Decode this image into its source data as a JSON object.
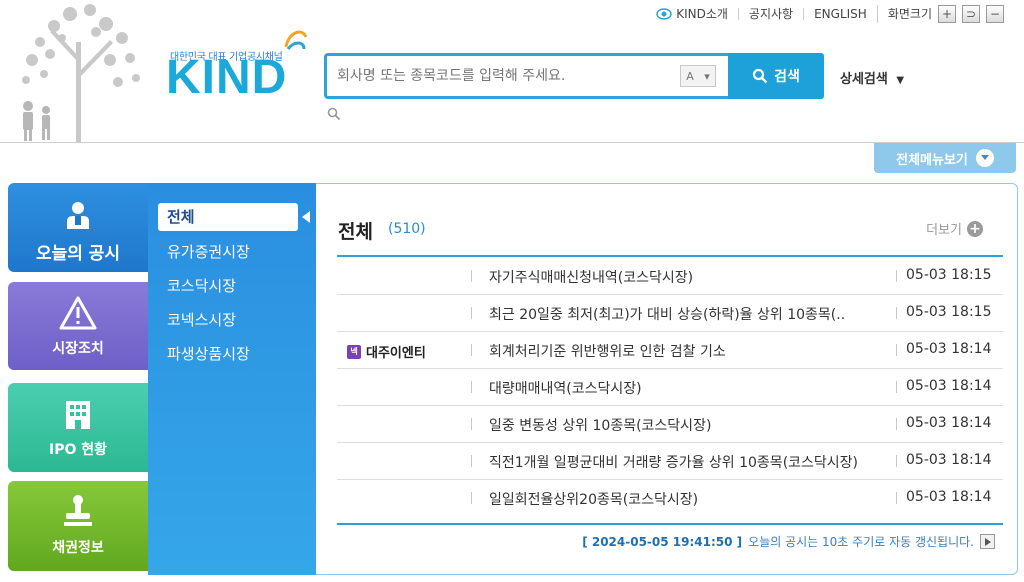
{
  "header": {
    "logo_sub": "대한민국 대표 기업공시채널",
    "logo_text": "KIND",
    "util": {
      "about": "KIND소개",
      "notice": "공지사항",
      "english": "ENGLISH",
      "screen_size": "화면크기",
      "plus": "+",
      "reset": "⊃",
      "minus": "−"
    },
    "search": {
      "placeholder": "회사명 또는 종목코드를 입력해 주세요.",
      "font_selector": "A",
      "button": "검색"
    },
    "advanced_search": "상세검색",
    "all_menu": "전체메뉴보기"
  },
  "tabs": [
    {
      "label": "오늘의 공시"
    },
    {
      "label": "시장조치"
    },
    {
      "label": "IPO 현황"
    },
    {
      "label": "채권정보"
    }
  ],
  "submenu": [
    {
      "label": "전체"
    },
    {
      "label": "유가증권시장"
    },
    {
      "label": "코스닥시장"
    },
    {
      "label": "코넥스시장"
    },
    {
      "label": "파생상품시장"
    }
  ],
  "main": {
    "title": "전체",
    "count": "(510)",
    "more": "더보기",
    "rows": [
      {
        "company": "",
        "badge": "",
        "title": "자기주식매매신청내역(코스닥시장)",
        "time": "05-03 18:15"
      },
      {
        "company": "",
        "badge": "",
        "title": "최근 20일중 최저(최고)가 대비 상승(하락)율 상위 10종목(..",
        "time": "05-03 18:15"
      },
      {
        "company": "대주이엔티",
        "badge": "넥",
        "title": "회계처리기준 위반행위로 인한 검찰 기소",
        "time": "05-03 18:14"
      },
      {
        "company": "",
        "badge": "",
        "title": "대량매매내역(코스닥시장)",
        "time": "05-03 18:14"
      },
      {
        "company": "",
        "badge": "",
        "title": "일중 변동성 상위 10종목(코스닥시장)",
        "time": "05-03 18:14"
      },
      {
        "company": "",
        "badge": "",
        "title": "직전1개월 일평균대비 거래량 증가율 상위 10종목(코스닥시장)",
        "time": "05-03 18:14"
      },
      {
        "company": "",
        "badge": "",
        "title": "일일회전율상위20종목(코스닥시장)",
        "time": "05-03 18:14"
      }
    ],
    "timestamp": "[ 2024-05-05 19:41:50 ]",
    "refresh_note": "오늘의 공시는 10초 주기로 자동 갱신됩니다."
  },
  "colors": {
    "accent": "#1ea0d8",
    "tab_today": "#2181d0",
    "tab_market": "#7a6bd0",
    "tab_ipo": "#34c29f",
    "tab_bond": "#6fb62a"
  }
}
